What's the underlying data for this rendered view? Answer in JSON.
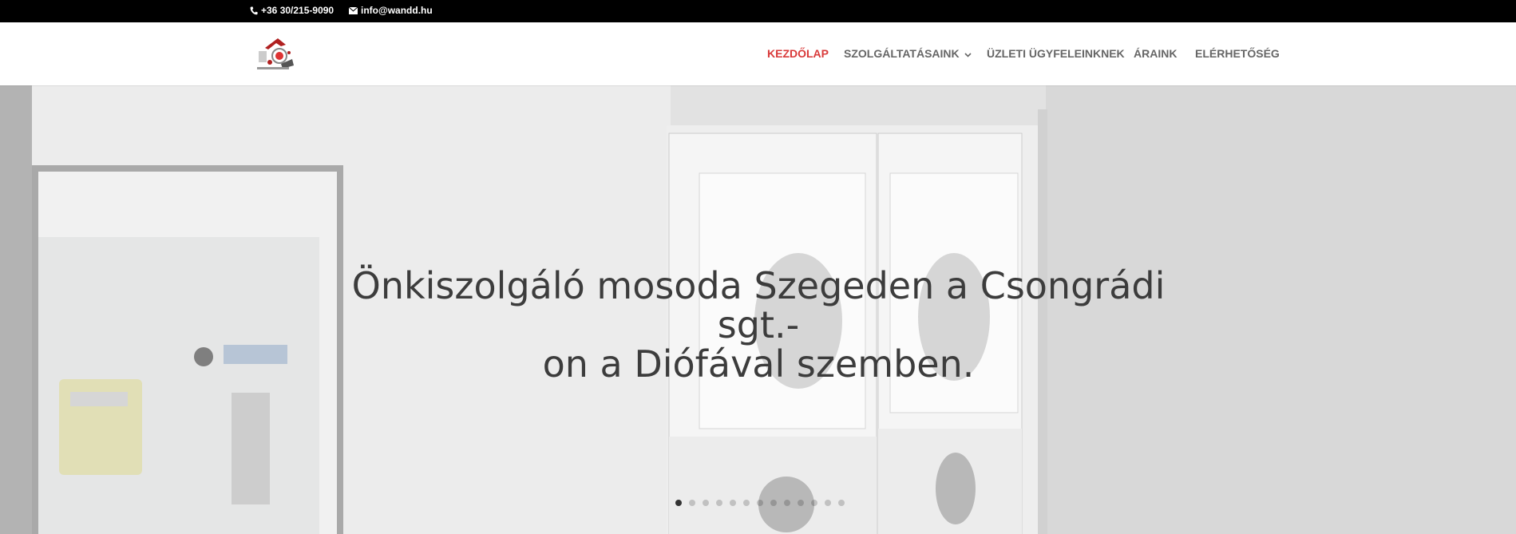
{
  "topbar": {
    "phone": "+36 30/215-9090",
    "phone_icon": "phone-icon",
    "email": "info@wandd.hu",
    "email_icon": "envelope-icon"
  },
  "header": {
    "logo_icon": "wandd-logo-icon",
    "nav": [
      {
        "label": "KEZDŐLAP",
        "active": true
      },
      {
        "label": "SZOLGÁLTATÁSAINK",
        "has_dropdown": true
      },
      {
        "label": "ÜZLETI ÜGYFELEINKNEK"
      },
      {
        "label": "ÁRAINK"
      },
      {
        "label": "ELÉRHETŐSÉG"
      }
    ],
    "accent_color": "#d93a3a"
  },
  "hero": {
    "title": "Önkiszolgáló mosoda Szegeden a Csongrádi sgt.-on a Diófával szemben.",
    "title_line1": "Önkiszolgáló mosoda Szegeden a Csongrádi sgt.-",
    "title_line2": "on a Diófával szemben.",
    "slider": {
      "total": 13,
      "active": 1
    }
  }
}
